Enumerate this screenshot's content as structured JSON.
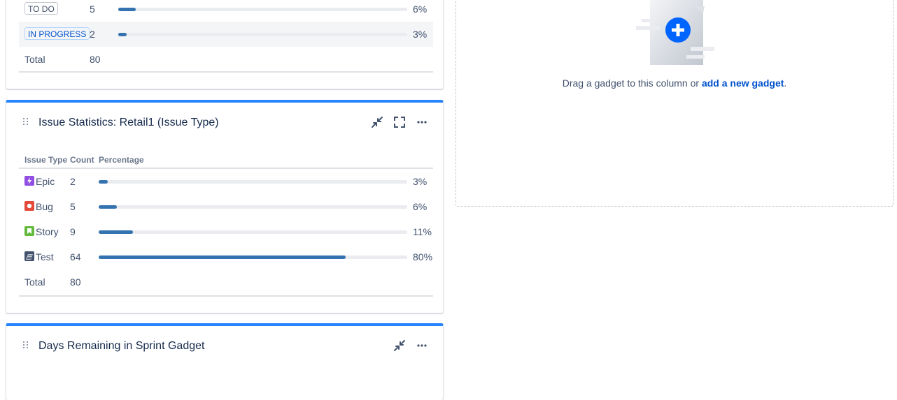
{
  "status_gadget": {
    "rows": [
      {
        "status": "TO DO",
        "count": "5",
        "percent": "6%",
        "fraction": 0.06
      },
      {
        "status": "IN PROGRESS",
        "count": "2",
        "percent": "3%",
        "fraction": 0.03
      }
    ],
    "total_label": "Total",
    "total_value": "80"
  },
  "issue_type_gadget": {
    "title": "Issue Statistics: Retail1 (Issue Type)",
    "columns": {
      "type": "Issue Type",
      "count": "Count",
      "percentage": "Percentage"
    },
    "rows": [
      {
        "type": "Epic",
        "icon": "epic-icon",
        "color": "#904ee2",
        "count": "2",
        "percent": "3%",
        "fraction": 0.03
      },
      {
        "type": "Bug",
        "icon": "bug-icon",
        "color": "#e5493a",
        "count": "5",
        "percent": "6%",
        "fraction": 0.06
      },
      {
        "type": "Story",
        "icon": "story-icon",
        "color": "#63ba3c",
        "count": "9",
        "percent": "11%",
        "fraction": 0.11
      },
      {
        "type": "Test",
        "icon": "test-icon",
        "color": "#42526e",
        "count": "64",
        "percent": "80%",
        "fraction": 0.8
      }
    ],
    "total_label": "Total",
    "total_value": "80"
  },
  "sprint_gadget": {
    "title": "Days Remaining in Sprint Gadget"
  },
  "dropzone": {
    "text_before": "Drag a gadget to this column or ",
    "link": "add a new gadget",
    "text_after": "."
  },
  "colors": {
    "accent": "#2684ff",
    "bar": "#3572b0",
    "link": "#0052cc"
  }
}
